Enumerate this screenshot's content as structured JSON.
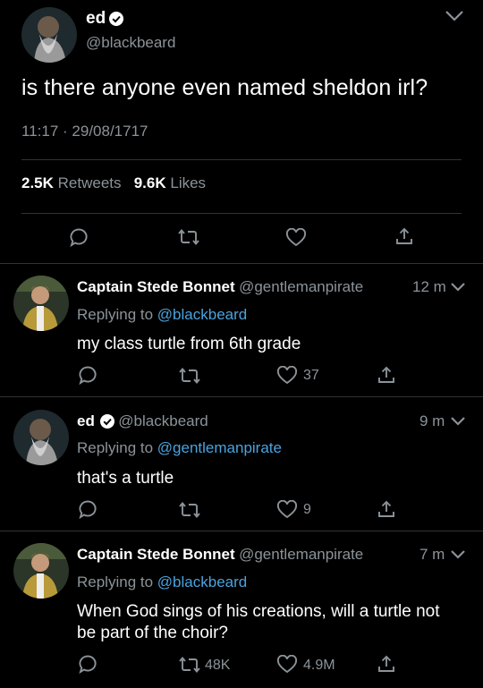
{
  "main_tweet": {
    "author_name": "ed",
    "author_handle": "@blackbeard",
    "text": "is there anyone even named sheldon irl?",
    "time": "11:17",
    "separator": "·",
    "date": "29/08/1717",
    "retweets_count": "2.5K",
    "retweets_label": "Retweets",
    "likes_count": "9.6K",
    "likes_label": "Likes"
  },
  "replies": [
    {
      "author_name": "Captain Stede Bonnet",
      "author_handle": "@gentlemanpirate",
      "time": "12 m",
      "replying_prefix": "Replying to",
      "replying_to": "@blackbeard",
      "text": "my class turtle from 6th grade",
      "retweets": "",
      "likes": "37"
    },
    {
      "author_name": "ed",
      "author_handle": "@blackbeard",
      "time": "9 m",
      "replying_prefix": "Replying to",
      "replying_to": "@gentlemanpirate",
      "text": "that's a turtle",
      "retweets": "",
      "likes": "9"
    },
    {
      "author_name": "Captain Stede Bonnet",
      "author_handle": "@gentlemanpirate",
      "time": "7 m",
      "replying_prefix": "Replying to",
      "replying_to": "@blackbeard",
      "text": "When God sings of his creations, will a turtle not be part of the choir?",
      "retweets": "48K",
      "likes": "4.9M"
    }
  ],
  "colors": {
    "background": "#000000",
    "secondary_text": "#8b9399",
    "link": "#4aa3df",
    "divider": "#2f3336"
  },
  "icons": [
    "chevron-down-icon",
    "verified-badge-icon",
    "reply-icon",
    "retweet-icon",
    "like-icon",
    "share-icon"
  ]
}
